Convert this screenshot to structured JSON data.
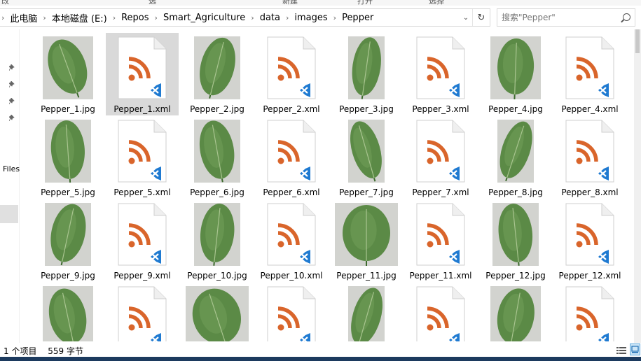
{
  "topstrip": [
    "改",
    "选",
    "新建",
    "打开",
    "选择"
  ],
  "address": {
    "crumbs": [
      "此电脑",
      "本地磁盘 (E:)",
      "Repos",
      "Smart_Agriculture",
      "data",
      "images",
      "Pepper"
    ]
  },
  "search": {
    "placeholder": "搜索\"Pepper\""
  },
  "navpane": {
    "label": "Files"
  },
  "files": [
    {
      "name": "Pepper_1.jpg",
      "kind": "jpg",
      "shape": "wide"
    },
    {
      "name": "Pepper_1.xml",
      "kind": "xml",
      "selected": true
    },
    {
      "name": "Pepper_2.jpg",
      "kind": "jpg",
      "shape": "tall"
    },
    {
      "name": "Pepper_2.xml",
      "kind": "xml"
    },
    {
      "name": "Pepper_3.jpg",
      "kind": "jpg",
      "shape": "narrow"
    },
    {
      "name": "Pepper_3.xml",
      "kind": "xml"
    },
    {
      "name": "Pepper_4.jpg",
      "kind": "jpg",
      "shape": "wide"
    },
    {
      "name": "Pepper_4.xml",
      "kind": "xml"
    },
    {
      "name": "Pepper_5.jpg",
      "kind": "jpg",
      "shape": "tall"
    },
    {
      "name": "Pepper_5.xml",
      "kind": "xml"
    },
    {
      "name": "Pepper_6.jpg",
      "kind": "jpg",
      "shape": "tall"
    },
    {
      "name": "Pepper_6.xml",
      "kind": "xml"
    },
    {
      "name": "Pepper_7.jpg",
      "kind": "jpg",
      "shape": "narrow"
    },
    {
      "name": "Pepper_7.xml",
      "kind": "xml"
    },
    {
      "name": "Pepper_8.jpg",
      "kind": "jpg",
      "shape": "narrow"
    },
    {
      "name": "Pepper_8.xml",
      "kind": "xml"
    },
    {
      "name": "Pepper_9.jpg",
      "kind": "jpg",
      "shape": "tall"
    },
    {
      "name": "Pepper_9.xml",
      "kind": "xml"
    },
    {
      "name": "Pepper_10.jpg",
      "kind": "jpg",
      "shape": "tall"
    },
    {
      "name": "Pepper_10.xml",
      "kind": "xml"
    },
    {
      "name": "Pepper_11.jpg",
      "kind": "jpg",
      "shape": "landscape"
    },
    {
      "name": "Pepper_11.xml",
      "kind": "xml"
    },
    {
      "name": "Pepper_12.jpg",
      "kind": "jpg",
      "shape": "tall"
    },
    {
      "name": "Pepper_12.xml",
      "kind": "xml"
    },
    {
      "name": "",
      "kind": "jpg",
      "shape": "wide"
    },
    {
      "name": "",
      "kind": "xml"
    },
    {
      "name": "",
      "kind": "jpg",
      "shape": "landscape"
    },
    {
      "name": "",
      "kind": "xml"
    },
    {
      "name": "",
      "kind": "jpg",
      "shape": "narrow"
    },
    {
      "name": "",
      "kind": "xml"
    },
    {
      "name": "",
      "kind": "jpg",
      "shape": "wide"
    },
    {
      "name": "",
      "kind": "xml"
    }
  ],
  "status": {
    "count": "1 个项目",
    "size": "559 字节"
  },
  "colors": {
    "rss": "#d9652b",
    "vs": "#1f7ad1",
    "leaf": "#5b8a46",
    "leafDark": "#3d6a2e",
    "photoBg": "#d2d3cf",
    "selected": "#d9d9d9"
  }
}
